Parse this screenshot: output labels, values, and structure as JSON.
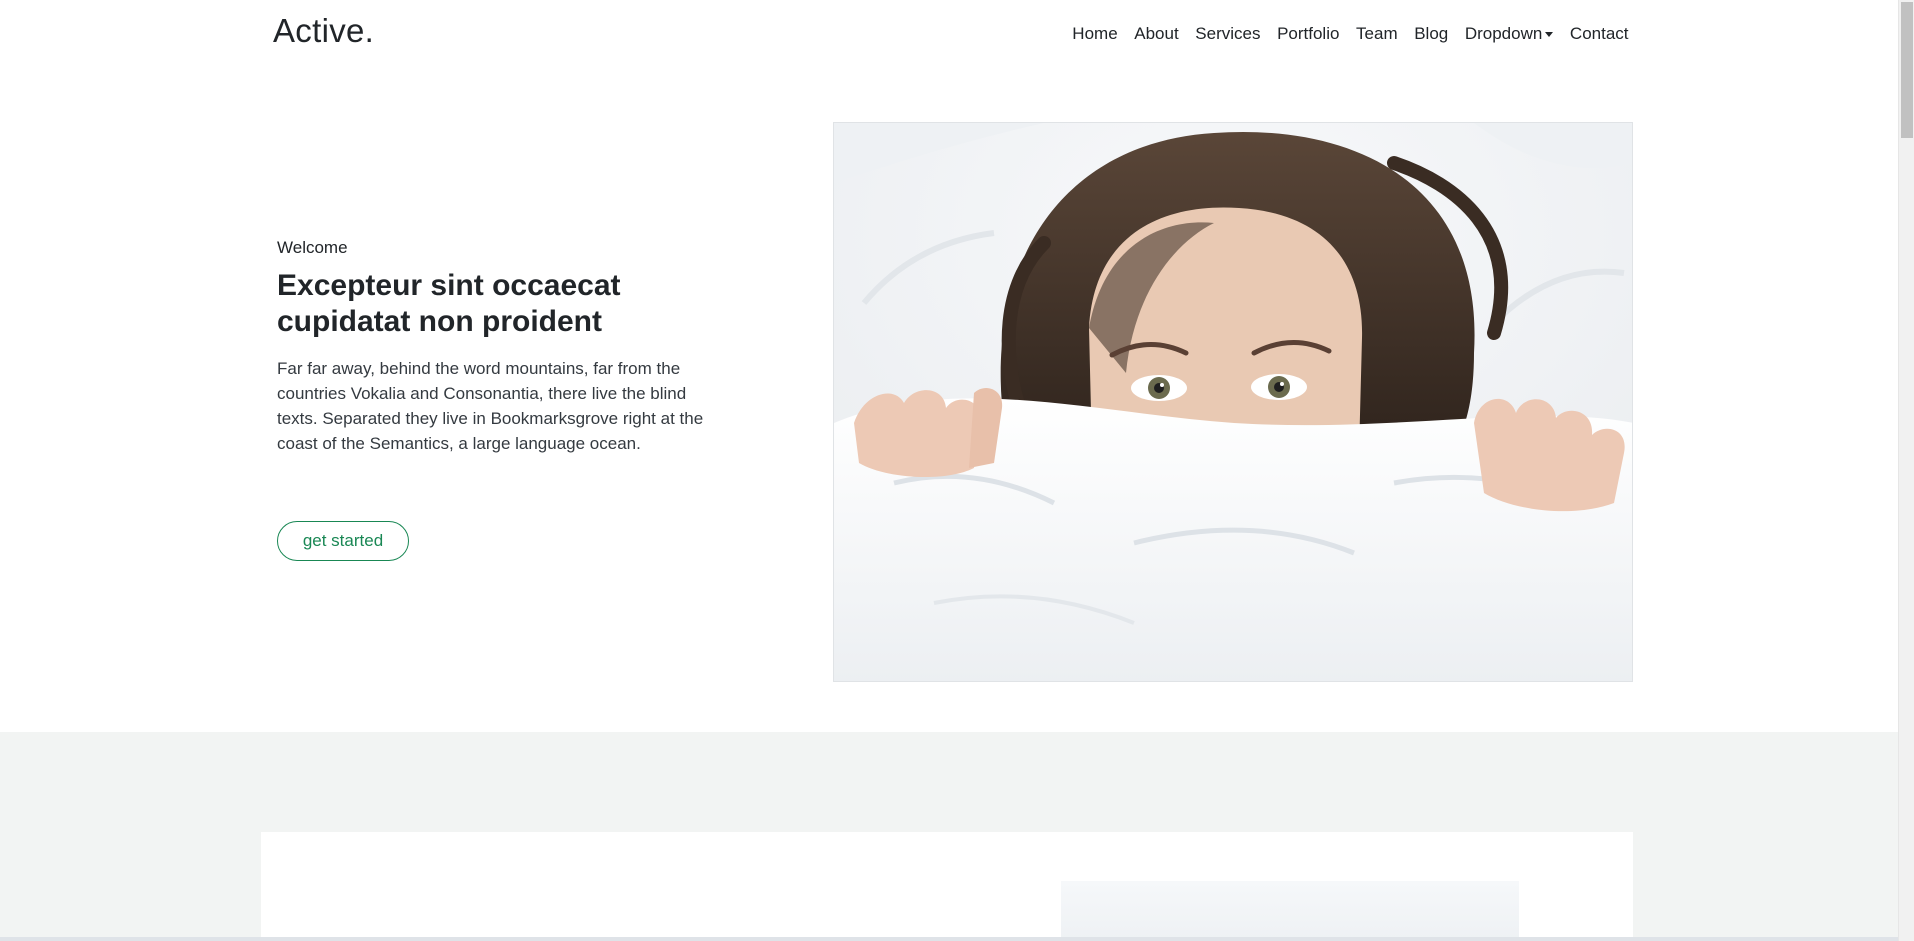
{
  "brand": "Active.",
  "nav": {
    "items": [
      "Home",
      "About",
      "Services",
      "Portfolio",
      "Team",
      "Blog",
      "Dropdown",
      "Contact"
    ]
  },
  "hero": {
    "kicker": "Welcome",
    "headline": "Excepteur sint occaecat cupidatat non proident",
    "lead": "Far far away, behind the word mountains, far from the countries Vokalia and Consonantia, there live the blind texts. Separated they live in Bookmarksgrove right at the coast of the Semantics, a large language ocean.",
    "cta": "get started"
  },
  "colors": {
    "accent": "#198754",
    "section_bg": "#f2f4f3"
  },
  "icons": {
    "dropdown": "caret-down-icon"
  }
}
